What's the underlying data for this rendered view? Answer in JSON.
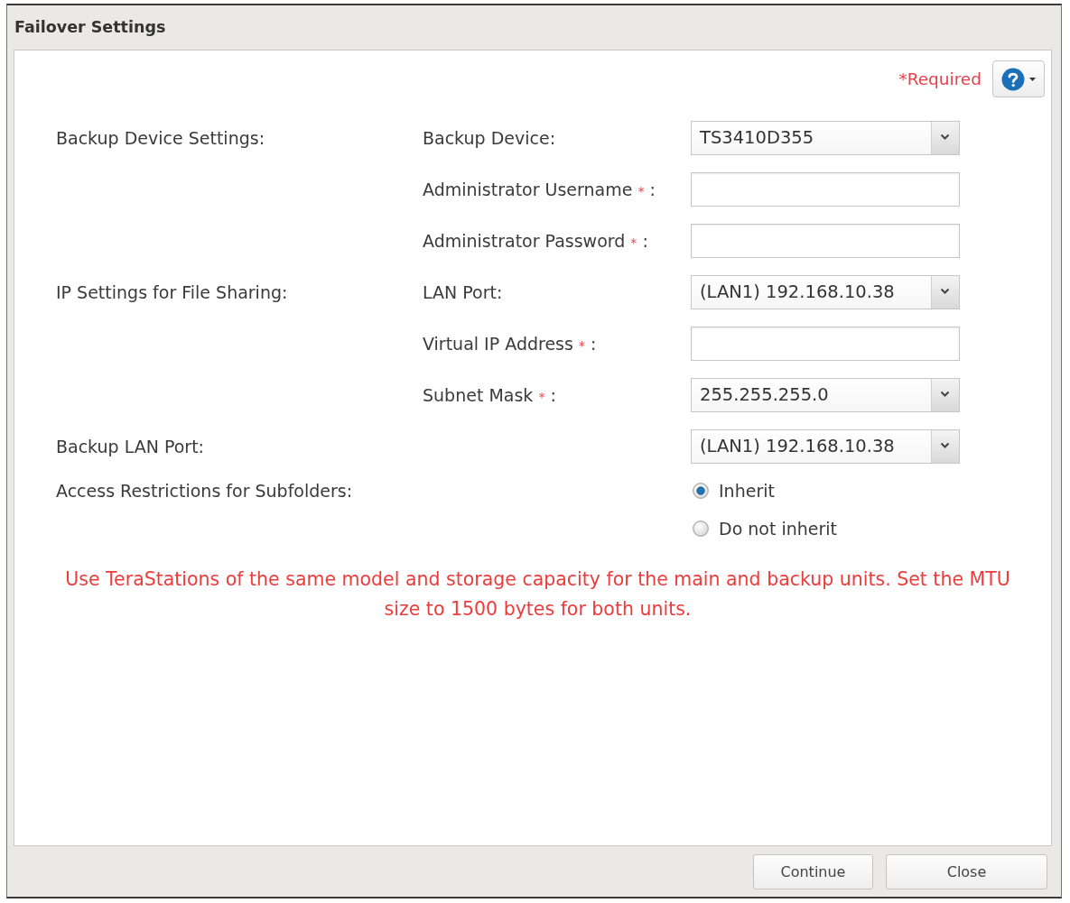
{
  "window": {
    "title": "Failover Settings"
  },
  "required_note": "*Required",
  "sections": [
    {
      "title": "Backup Device Settings:",
      "rows": [
        {
          "kind": "select",
          "label": "Backup Device:",
          "value": "TS3410D355"
        },
        {
          "kind": "text",
          "label": "Administrator Username",
          "required_mark": "*",
          "label_suffix": ":"
        },
        {
          "kind": "text",
          "label": "Administrator Password",
          "required_mark": "*",
          "label_suffix": ":"
        }
      ]
    },
    {
      "title": "IP Settings for File Sharing:",
      "rows": [
        {
          "kind": "select",
          "label": "LAN Port:",
          "value": "(LAN1) 192.168.10.38"
        },
        {
          "kind": "text",
          "label": "Virtual IP Address",
          "required_mark": "*",
          "label_suffix": ":"
        },
        {
          "kind": "select",
          "label": "Subnet Mask",
          "required_mark": "*",
          "label_suffix": ":",
          "value": "255.255.255.0"
        }
      ]
    },
    {
      "title": "Backup LAN Port:",
      "rows": [
        {
          "kind": "select",
          "value": "(LAN1) 192.168.10.38"
        }
      ]
    },
    {
      "title": "Access Restrictions for Subfolders:",
      "rows": [
        {
          "kind": "radio",
          "options": [
            {
              "label": "Inherit",
              "selected": true
            },
            {
              "label": "Do not inherit",
              "selected": false
            }
          ]
        }
      ]
    }
  ],
  "notice": "Use TeraStations of the same model and storage capacity for the main and backup units. Set the MTU size to 1500 bytes for both units.",
  "buttons": [
    {
      "label": "Continue"
    },
    {
      "label": "Close"
    }
  ]
}
